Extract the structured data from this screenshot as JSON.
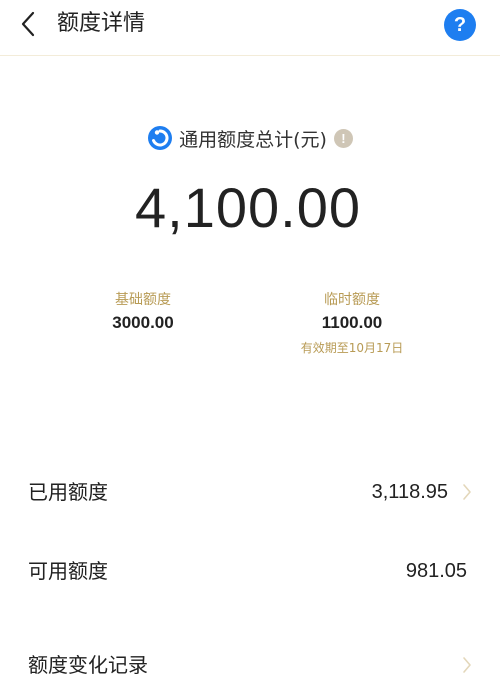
{
  "header": {
    "title": "额度详情",
    "help_label": "?"
  },
  "summary": {
    "total_label": "通用额度总计(元)",
    "info_label": "!",
    "total_amount": "4,100.00",
    "base": {
      "label": "基础额度",
      "value": "3000.00"
    },
    "temporary": {
      "label": "临时额度",
      "value": "1100.00",
      "note": "有效期至10月17日"
    }
  },
  "rows": {
    "used": {
      "label": "已用额度",
      "value": "3,118.95"
    },
    "available": {
      "label": "可用额度",
      "value": "981.05"
    },
    "history": {
      "label": "额度变化记录"
    }
  },
  "colors": {
    "accent_gold": "#b89b55",
    "help_blue": "#1e7ef0",
    "info_gray": "#cfc6b6"
  },
  "icons": {
    "back": "chevron-left-icon",
    "help": "question-mark-icon",
    "brand": "brand-logo-icon",
    "info": "exclamation-icon",
    "row_arrow": "chevron-right-icon"
  }
}
